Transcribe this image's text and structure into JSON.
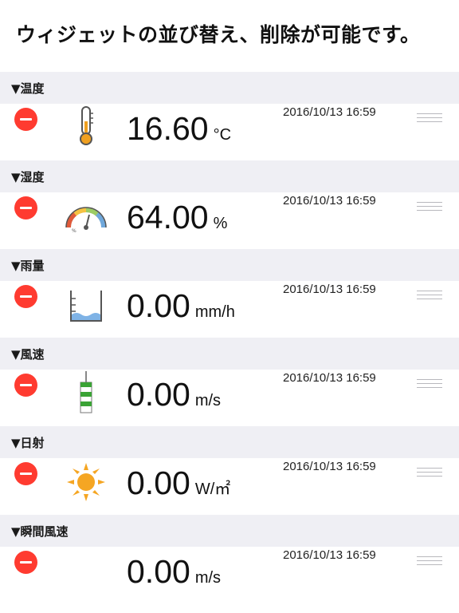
{
  "header": {
    "title": "ウィジェットの並び替え、削除が可能です。"
  },
  "sections": [
    {
      "title": "▼温度",
      "icon": "thermometer-icon",
      "value": "16.60",
      "unit": "°C",
      "timestamp": "2016/10/13 16:59"
    },
    {
      "title": "▼湿度",
      "icon": "humidity-gauge-icon",
      "value": "64.00",
      "unit": "%",
      "timestamp": "2016/10/13 16:59"
    },
    {
      "title": "▼雨量",
      "icon": "rain-gauge-beaker-icon",
      "value": "0.00",
      "unit": "mm/h",
      "timestamp": "2016/10/13 16:59"
    },
    {
      "title": "▼風速",
      "icon": "windsock-icon",
      "value": "0.00",
      "unit": "m/s",
      "timestamp": "2016/10/13 16:59"
    },
    {
      "title": "▼日射",
      "icon": "sun-icon",
      "value": "0.00",
      "unit": "W/㎡",
      "timestamp": "2016/10/13 16:59"
    },
    {
      "title": "▼瞬間風速",
      "icon": "",
      "value": "0.00",
      "unit": "m/s",
      "timestamp": "2016/10/13 16:59"
    }
  ],
  "colors": {
    "delete": "#ff3b30",
    "section_bg": "#efeff4",
    "thermometer": "#f0a020",
    "windsock_green": "#3aa335",
    "sun": "#f5a623",
    "water": "#7fb3e6"
  }
}
